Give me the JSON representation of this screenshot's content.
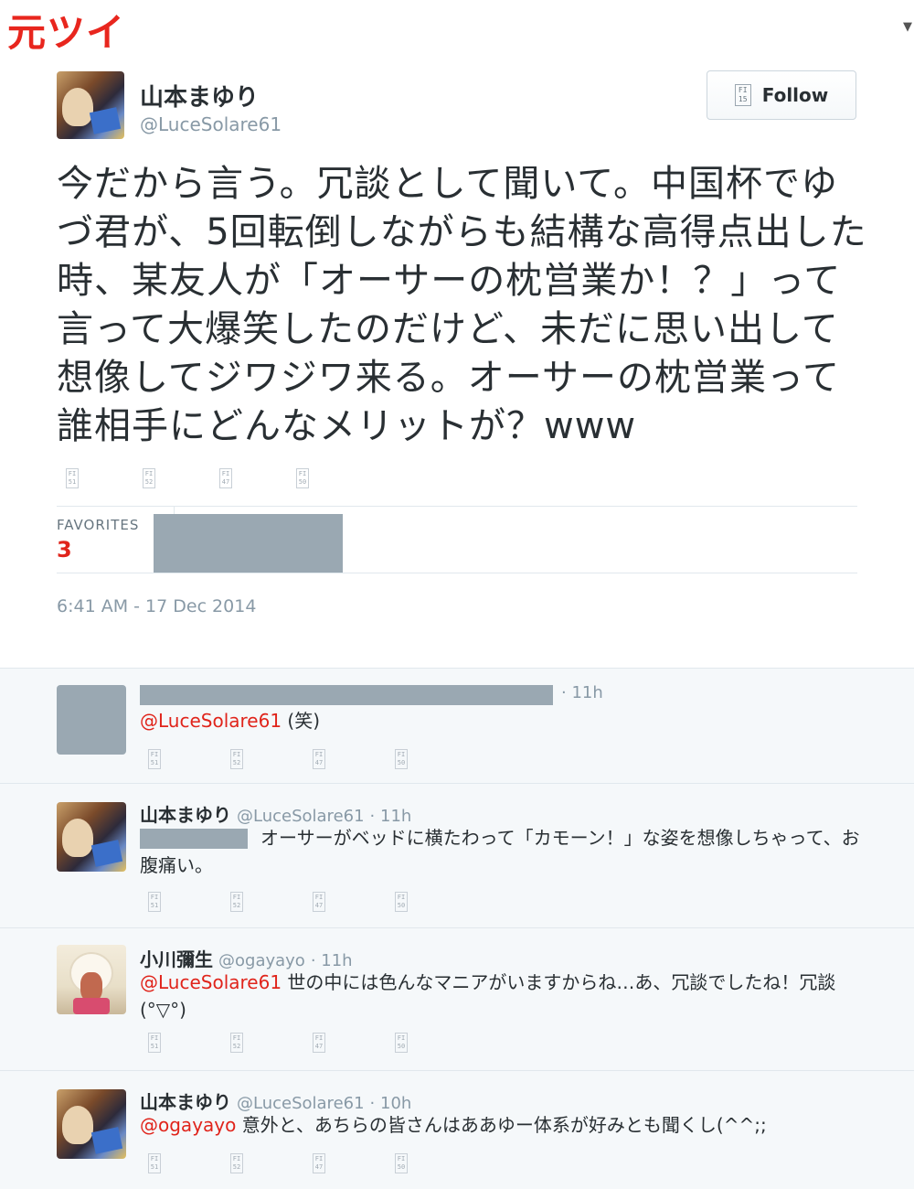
{
  "corner_label": "元ツイ",
  "main_tweet": {
    "name": "山本まゆり",
    "handle": "@LuceSolare61",
    "follow_label": "Follow",
    "follow_icon": "FI 15",
    "text": "今だから言う。冗談として聞いて。中国杯でゆづ君が、5回転倒しながらも結構な高得点出した時、某友人が「オーサーの枕営業か！？」って言って大爆笑したのだけど、未だに思い出して想像してジワジワ来る。オーサーの枕営業って誰相手にどんなメリットが？www",
    "action_icons": [
      "FI 51",
      "FI 52",
      "FI 47",
      "FI 50"
    ],
    "favorites_label": "FAVORITES",
    "favorites_count": "3",
    "timestamp": "6:41 AM - 17 Dec 2014"
  },
  "replies": [
    {
      "name": "",
      "handle": "",
      "time": "· 11h",
      "mention": "@LuceSolare61",
      "text": " (笑)",
      "action_icons": [
        "FI 51",
        "FI 52",
        "FI 47",
        "FI 50"
      ]
    },
    {
      "name": "山本まゆり",
      "handle": "@LuceSolare61",
      "time": "· 11h",
      "mention": "",
      "text": "オーサーがベッドに横たわって「カモーン！」な姿を想像しちゃって、お腹痛い。",
      "action_icons": [
        "FI 51",
        "FI 52",
        "FI 47",
        "FI 50"
      ]
    },
    {
      "name": "小川彌生",
      "handle": "@ogayayo",
      "time": "· 11h",
      "mention": "@LuceSolare61",
      "text": " 世の中には色んなマニアがいますからね…あ、冗談でしたね！冗談(°▽°)",
      "action_icons": [
        "FI 51",
        "FI 52",
        "FI 47",
        "FI 50"
      ]
    },
    {
      "name": "山本まゆり",
      "handle": "@LuceSolare61",
      "time": "· 10h",
      "mention": "@ogayayo",
      "text": " 意外と、あちらの皆さんはああゆー体系が好みとも聞くし(^^;;",
      "action_icons": [
        "FI 51",
        "FI 52",
        "FI 47",
        "FI 50"
      ]
    }
  ]
}
